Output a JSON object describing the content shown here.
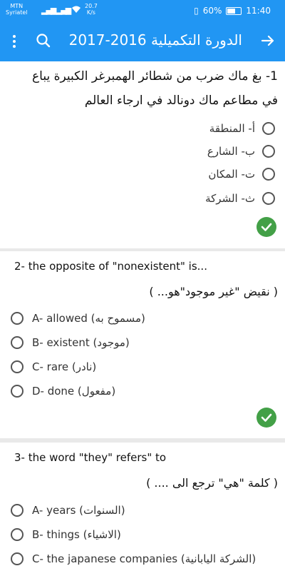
{
  "status_bar": {
    "carrier_line1": "MTN",
    "carrier_line2": "Syriatel",
    "speed_value": "20.7",
    "speed_unit": "K/s",
    "battery_percent": "60%",
    "battery_level": 0.6,
    "time": "11:40"
  },
  "app_bar": {
    "title": "الدورة التكميلية 2016-2017"
  },
  "questions": [
    {
      "text_line1": "1- بغ ماك ضرب من شطائر الهمبرغر الكبيرة يباع",
      "text_line2": "في مطاعم ماك دونالد في ارجاء العالم",
      "options": [
        "أ- المنطقة",
        "ب- الشارع",
        "ت- المكان",
        "ث- الشركة"
      ]
    },
    {
      "text_line1": "2- the opposite of \"nonexistent\" is...",
      "text_line2": "( نقيض \"غير موجود\"هو... )",
      "options": [
        "A- allowed (مسموح به)",
        "B- existent (موجود)",
        "C- rare (نادر)",
        "D- done (مفعول)"
      ]
    },
    {
      "text_line1": "3- the word \"they\" refers\" to",
      "text_line2": "( كلمة \"هي\" ترجع الى .... )",
      "options": [
        "A- years (السنوات)",
        "B- things (الاشياء)",
        "C- the japanese companies (الشركة اليابانية)"
      ]
    }
  ],
  "colors": {
    "primary": "#2196f3",
    "success": "#43a047",
    "background": "#e9e9e9"
  }
}
